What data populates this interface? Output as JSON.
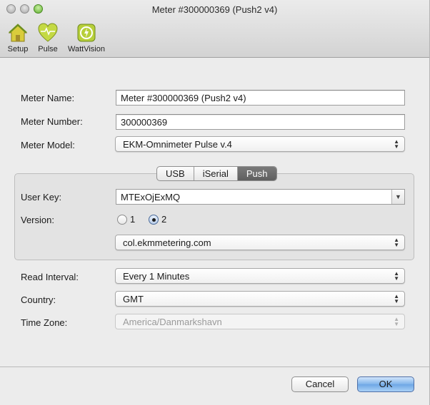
{
  "window": {
    "title": "Meter #300000369 (Push2 v4)"
  },
  "toolbar": {
    "items": [
      {
        "label": "Setup",
        "icon": "house-icon"
      },
      {
        "label": "Pulse",
        "icon": "heart-icon"
      },
      {
        "label": "WattVision",
        "icon": "wattvision-icon"
      }
    ]
  },
  "form": {
    "meter_name_label": "Meter Name:",
    "meter_name_value": "Meter #300000369 (Push2 v4)",
    "meter_number_label": "Meter Number:",
    "meter_number_value": "300000369",
    "meter_model_label": "Meter Model:",
    "meter_model_value": "EKM-Omnimeter Pulse v.4"
  },
  "connection": {
    "tabs": [
      "USB",
      "iSerial",
      "Push"
    ],
    "active_tab": "Push",
    "user_key_label": "User Key:",
    "user_key_value": "MTExOjExMQ",
    "version_label": "Version:",
    "version_options": [
      "1",
      "2"
    ],
    "version_selected": "2",
    "server_value": "col.ekmmetering.com"
  },
  "settings": {
    "read_interval_label": "Read Interval:",
    "read_interval_value": "Every 1 Minutes",
    "country_label": "Country:",
    "country_value": "GMT",
    "time_zone_label": "Time Zone:",
    "time_zone_value": "America/Danmarkshavn"
  },
  "buttons": {
    "cancel": "Cancel",
    "ok": "OK"
  },
  "colors": {
    "accent": "#6ea7e5",
    "active_tab": "#6b6b6b",
    "window_bg": "#ececec"
  }
}
